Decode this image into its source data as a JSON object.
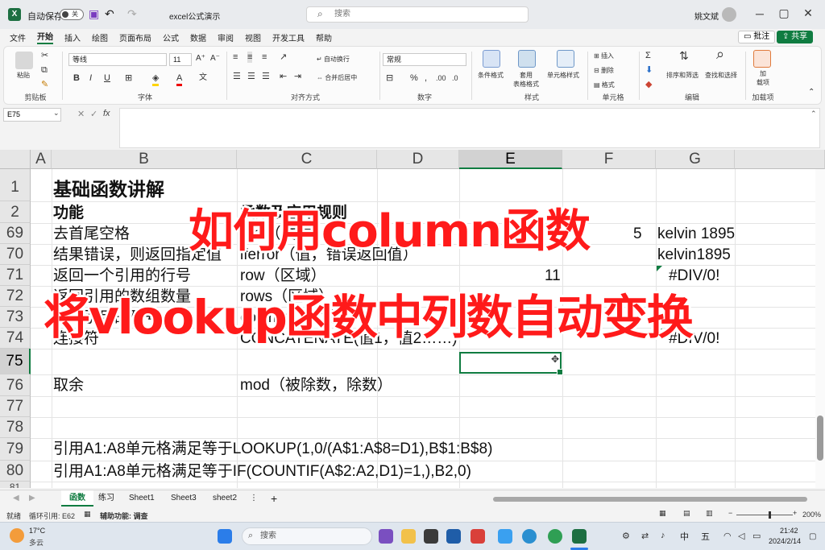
{
  "titlebar": {
    "autosave": "自动保存",
    "toggle": "关",
    "doc": "excel公式演示",
    "search_placeholder": "搜索",
    "user": "姚文斌"
  },
  "menu": [
    "文件",
    "开始",
    "插入",
    "绘图",
    "页面布局",
    "公式",
    "数据",
    "审阅",
    "视图",
    "开发工具",
    "帮助"
  ],
  "menu_right": {
    "comment": "批注",
    "share": "共享"
  },
  "ribbon": {
    "groups": {
      "clipboard": "剪贴板",
      "font": "字体",
      "align": "对齐方式",
      "number": "数字",
      "styles": "样式",
      "cells": "单元格",
      "edit": "编辑",
      "addins": "加载项"
    },
    "paste": "粘贴",
    "font_name": "等线",
    "font_size": "11",
    "wrap": "自动换行",
    "merge": "合并后居中",
    "num_fmt": "常规",
    "cond": "条件格式",
    "table": "套用\n表格格式",
    "cellstyle": "单元格样式",
    "insert": "插入",
    "delete": "删除",
    "format": "格式",
    "sort": "排序和筛选",
    "find": "查找和选择",
    "addin": "加\n载项"
  },
  "formula_bar": {
    "name_box": "E75",
    "fx": "fx"
  },
  "columns": [
    "A",
    "B",
    "C",
    "D",
    "E",
    "F",
    "G"
  ],
  "rows": [
    {
      "num": "1",
      "B": "基础函数讲解"
    },
    {
      "num": "2",
      "B": "功能",
      "C": "函数及应用规则"
    },
    {
      "num": "69",
      "B": "去首尾空格",
      "C": "trim（文本）",
      "F": "5",
      "G": "kelvin 1895"
    },
    {
      "num": "70",
      "B": "结果错误，则返回指定值",
      "C": "iferror（值，错误返回值）",
      "G": "kelvin1895"
    },
    {
      "num": "71",
      "B": "返回一个引用的行号",
      "C": "row（区域）",
      "E": "11",
      "G": "#DIV/0!"
    },
    {
      "num": "72",
      "B": "返回引用的数组数量",
      "C": "rows（区域）"
    },
    {
      "num": "73",
      "B": "返回引用的列号",
      "C": "column（区域）"
    },
    {
      "num": "74",
      "B": "连接符",
      "C": "CONCATENATE(值1，值2……)",
      "G": "#DIV/0!"
    },
    {
      "num": "75"
    },
    {
      "num": "76",
      "B": "取余",
      "C": "mod（被除数，除数）"
    },
    {
      "num": "77"
    },
    {
      "num": "78"
    },
    {
      "num": "79",
      "B": "引用A1:A8单元格满足等于LOOKUP(1,0/(A$1:A$8=D1),B$1:B$8)"
    },
    {
      "num": "80",
      "B": "引用A1:A8单元格满足等于IF(COUNTIF(A$2:A2,D1)=1,),B2,0)"
    },
    {
      "num": "81"
    }
  ],
  "overlay": {
    "line1": "如何用column函数",
    "line2": "将vlookup函数中列数自动变换"
  },
  "tabs": [
    "函数",
    "练习",
    "Sheet1",
    "Sheet3",
    "sheet2"
  ],
  "status": {
    "ready": "就绪",
    "circular": "循环引用: E62",
    "accessibility": "辅助功能: 调查",
    "zoom": "200%"
  },
  "taskbar": {
    "temp": "17°C",
    "weather": "多云",
    "search": "搜索",
    "ime1": "中",
    "ime2": "五",
    "time": "21:42",
    "date": "2024/2/14"
  }
}
